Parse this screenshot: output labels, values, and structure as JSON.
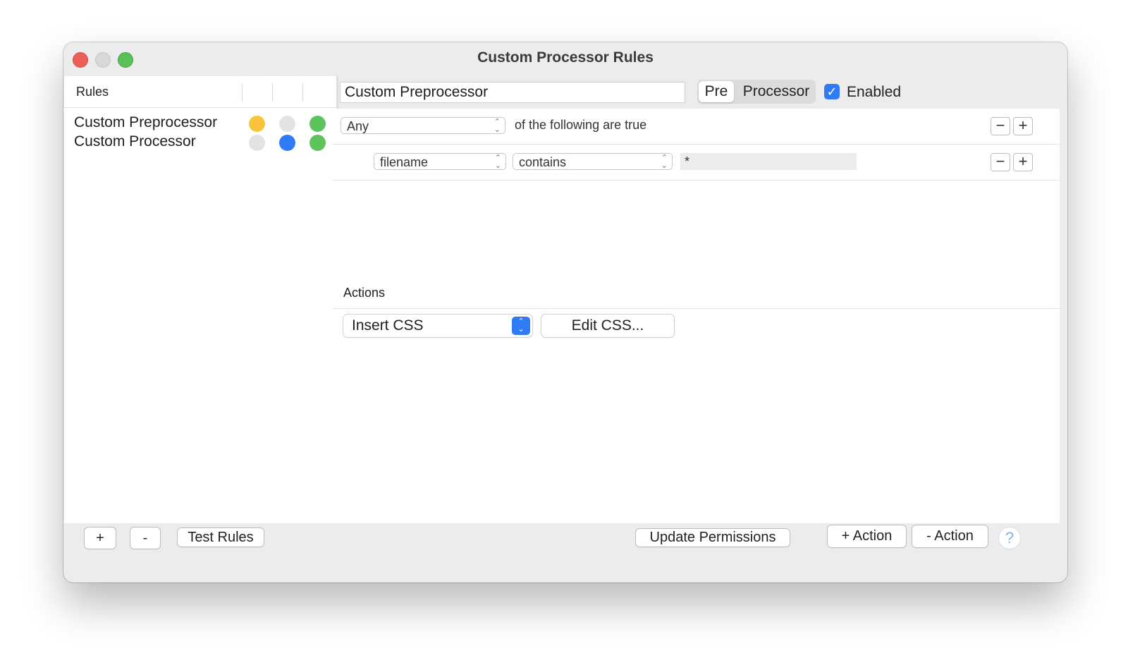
{
  "window": {
    "title": "Custom Processor Rules"
  },
  "rules": {
    "header": "Rules",
    "items": [
      {
        "label": "Custom Preprocessor",
        "status_colors": [
          "#f6c53c",
          "#e3e3e3",
          "#5cc45a"
        ]
      },
      {
        "label": "Custom Processor",
        "status_colors": [
          "#e3e3e3",
          "#2f7bf5",
          "#5cc45a"
        ]
      }
    ]
  },
  "editor": {
    "name_value": "Custom Preprocessor",
    "segment": {
      "pre_label": "Pre",
      "processor_label": "Processor",
      "selected": "Pre"
    },
    "enabled": {
      "label": "Enabled",
      "checked": true
    }
  },
  "conditions": {
    "match_select": "Any",
    "match_text": "of the following are true",
    "rows": [
      {
        "field": "filename",
        "operator": "contains",
        "value": "*"
      }
    ]
  },
  "actions": {
    "header": "Actions",
    "action_select": "Insert CSS",
    "edit_button": "Edit CSS..."
  },
  "footer": {
    "add": "+",
    "remove": "-",
    "test_rules": "Test Rules",
    "update_permissions": "Update Permissions",
    "add_action": "+ Action",
    "remove_action": "- Action",
    "help": "?"
  },
  "colors": {
    "accent": "#2f7bf5",
    "close": "#ec5f57",
    "minimize": "#d8d8d8",
    "zoom": "#5ac05a"
  }
}
